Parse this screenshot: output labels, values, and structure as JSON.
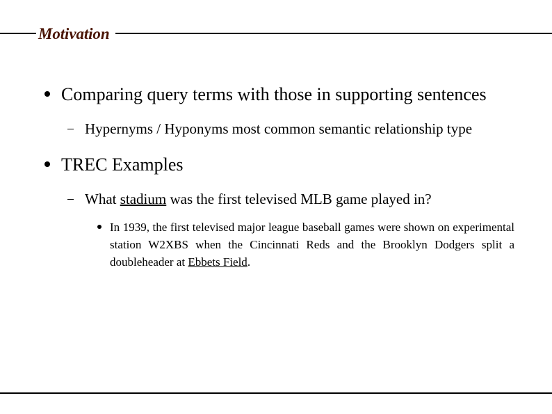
{
  "slide": {
    "title": "Motivation",
    "title_color": "#4a1505",
    "background_color": "#ffffff",
    "rule_color": "#000000"
  },
  "content": {
    "bullets": [
      {
        "level": 1,
        "marker": "round-bullet",
        "text": "Comparing query terms with those in supporting sentences"
      },
      {
        "level": 2,
        "marker": "en-dash",
        "text": "Hypernyms / Hyponyms most common semantic relationship type"
      },
      {
        "level": 1,
        "marker": "round-bullet",
        "text": "TREC Examples"
      },
      {
        "level": 2,
        "marker": "en-dash",
        "text_before": "What ",
        "underlined": "stadium",
        "text_after": " was the first televised MLB game played in?"
      },
      {
        "level": 3,
        "marker": "round-bullet",
        "text_before": "In 1939, the first televised major league baseball games were shown on experimental station W2XBS when the Cincinnati Reds and the Brooklyn Dodgers split a doubleheader at ",
        "underlined": "Ebbets Field",
        "text_after": "."
      }
    ]
  }
}
